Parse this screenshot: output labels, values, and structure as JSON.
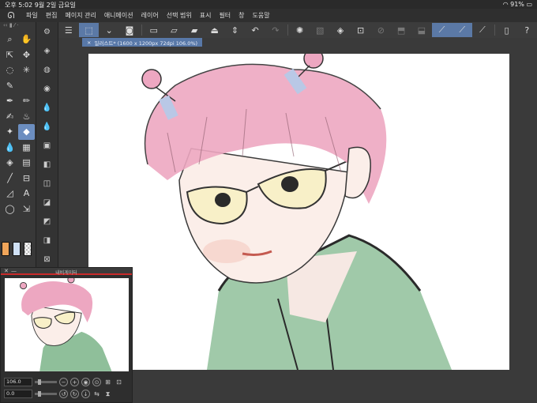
{
  "status": {
    "time": "오후 5:02",
    "date": "9월 2일 금요일",
    "battery": "91%"
  },
  "menu": [
    "파일",
    "편집",
    "페이지 관리",
    "애니메이션",
    "레이어",
    "선택 범위",
    "표시",
    "필터",
    "창",
    "도움말"
  ],
  "document_tab": {
    "title": "일러스트* (1600 x 1200px 72dpi 106.0%)"
  },
  "navigator": {
    "title": "내비게이터",
    "zoom": "106.0",
    "rotation": "0.0"
  },
  "colors": {
    "accent": "#5b79a6",
    "main_color": "#f0a55a",
    "sub_color": "#cfe0f5",
    "navigator_accent": "#c92b2b"
  }
}
